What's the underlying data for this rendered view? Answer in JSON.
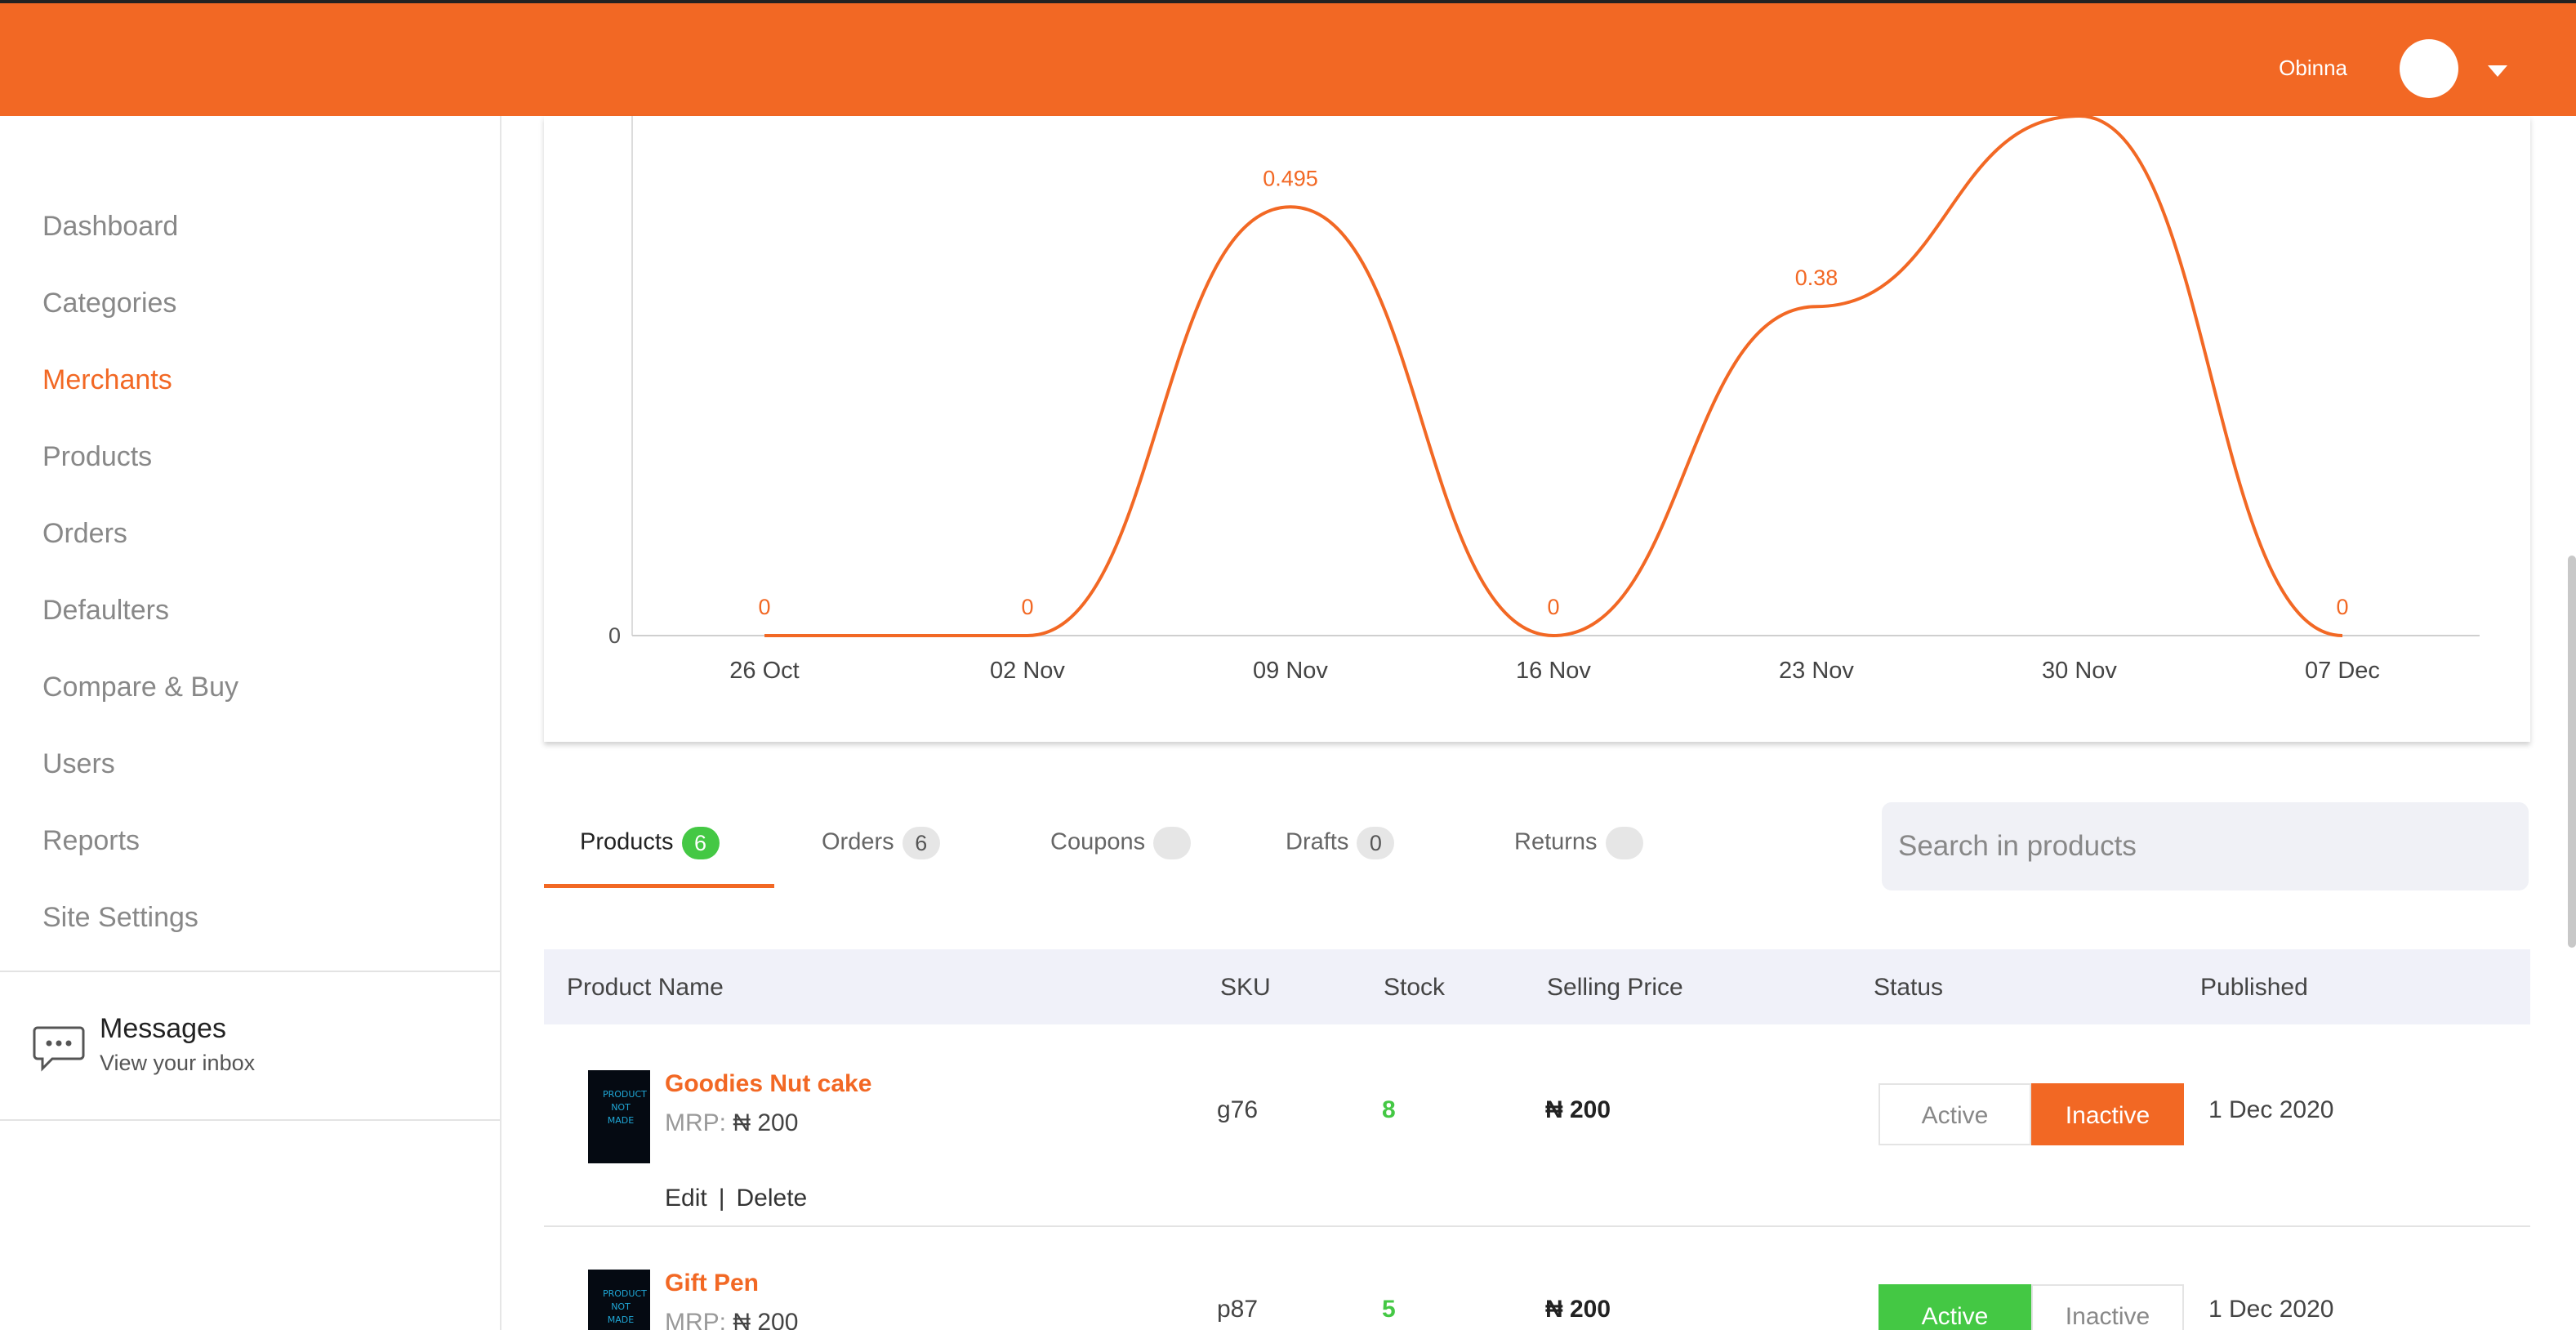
{
  "header": {
    "user_name": "Obinna"
  },
  "sidebar": {
    "items": [
      {
        "label": "Dashboard",
        "active": false
      },
      {
        "label": "Categories",
        "active": false
      },
      {
        "label": "Merchants",
        "active": true
      },
      {
        "label": "Products",
        "active": false
      },
      {
        "label": "Orders",
        "active": false
      },
      {
        "label": "Defaulters",
        "active": false
      },
      {
        "label": "Compare & Buy",
        "active": false
      },
      {
        "label": "Users",
        "active": false
      },
      {
        "label": "Reports",
        "active": false
      },
      {
        "label": "Site Settings",
        "active": false
      }
    ],
    "messages": {
      "title": "Messages",
      "subtitle": "View your inbox"
    }
  },
  "colors": {
    "brand": "#f26824",
    "success": "#44c844"
  },
  "chart_data": {
    "type": "line",
    "categories": [
      "26 Oct",
      "02 Nov",
      "09 Nov",
      "16 Nov",
      "23 Nov",
      "30 Nov",
      "07 Dec"
    ],
    "values": [
      0,
      0,
      0.495,
      0,
      0.38,
      0.6,
      0
    ],
    "data_labels": [
      "0",
      "0",
      "0.495",
      "0",
      "0.38",
      "",
      "0"
    ],
    "y_tick_labels": [
      "0"
    ],
    "ylim": [
      0,
      0.6
    ],
    "smooth": true,
    "color": "#f26824",
    "grid": false,
    "legend": "none"
  },
  "tabs": [
    {
      "label": "Products",
      "count": "6",
      "active": true
    },
    {
      "label": "Orders",
      "count": "6",
      "active": false
    },
    {
      "label": "Coupons",
      "count": "",
      "active": false
    },
    {
      "label": "Drafts",
      "count": "0",
      "active": false
    },
    {
      "label": "Returns",
      "count": "",
      "active": false
    }
  ],
  "search": {
    "placeholder": "Search in products"
  },
  "table": {
    "columns": [
      "Product Name",
      "SKU",
      "Stock",
      "Selling Price",
      "Status",
      "Published"
    ],
    "rows": [
      {
        "name": "Goodies Nut cake",
        "mrp_label": "MRP:",
        "mrp_value": "₦ 200",
        "edit": "Edit",
        "delete": "Delete",
        "sku": "g76",
        "stock": "8",
        "price": "₦ 200",
        "status": "Inactive",
        "active_label": "Active",
        "inactive_label": "Inactive",
        "published": "1 Dec 2020",
        "thumb_text": "PRODUCT NOT MADE"
      },
      {
        "name": "Gift Pen",
        "mrp_label": "MRP:",
        "mrp_value": "₦ 200",
        "sku": "p87",
        "stock": "5",
        "price": "₦ 200",
        "status": "Active",
        "active_label": "Active",
        "inactive_label": "Inactive",
        "published": "1 Dec 2020",
        "thumb_text": "PRODUCT NOT MADE"
      }
    ]
  }
}
